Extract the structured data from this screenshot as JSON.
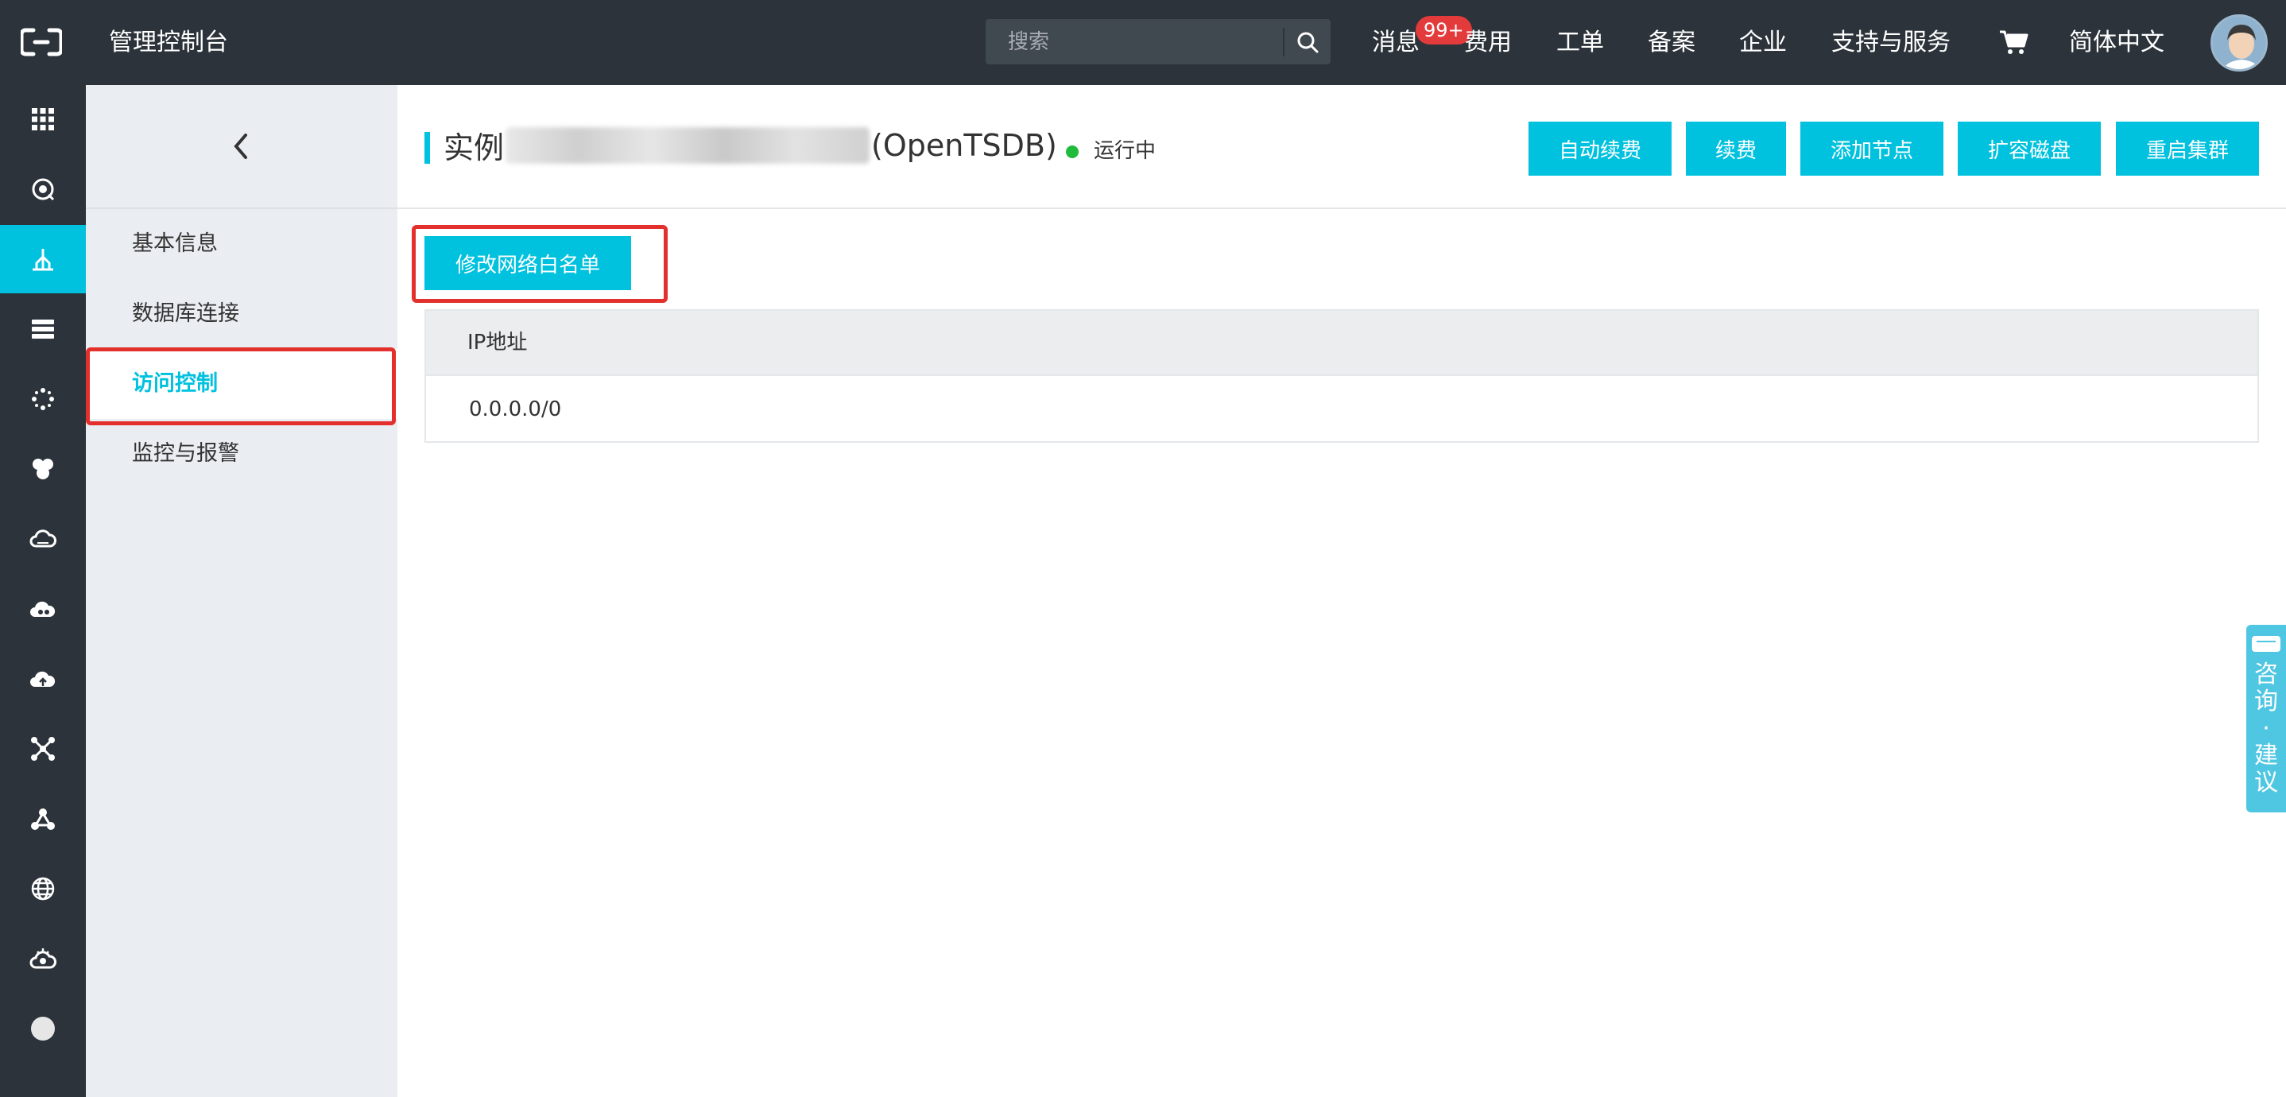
{
  "header": {
    "console_title": "管理控制台",
    "search_placeholder": "搜索",
    "nav": {
      "messages": "消息",
      "messages_badge": "99+",
      "billing": "费用",
      "tickets": "工单",
      "icp": "备案",
      "enterprise": "企业",
      "support": "支持与服务",
      "language": "简体中文"
    }
  },
  "rail": {
    "icons": [
      "grid-icon",
      "search-monitor-icon",
      "tsdb-icon",
      "database-icon",
      "dots-icon",
      "cluster-icon",
      "cloud-icon",
      "cloud-group-icon",
      "cloud-upload-icon",
      "network-icon",
      "share-icon",
      "globe-icon",
      "settings-cloud-icon",
      "circle-icon"
    ],
    "active_index": 2
  },
  "subnav": {
    "items": [
      {
        "label": "基本信息"
      },
      {
        "label": "数据库连接"
      },
      {
        "label": "访问控制"
      },
      {
        "label": "监控与报警"
      }
    ],
    "active_index": 2
  },
  "instance": {
    "title_prefix": "实例",
    "title_suffix": "(OpenTSDB)",
    "status": "运行中",
    "status_color": "#1fbb3a"
  },
  "actions": {
    "auto_renew": "自动续费",
    "renew": "续费",
    "add_node": "添加节点",
    "expand_disk": "扩容磁盘",
    "restart_cluster": "重启集群"
  },
  "access_control": {
    "modify_whitelist": "修改网络白名单",
    "table_header": "IP地址",
    "rows": [
      "0.0.0.0/0"
    ]
  },
  "consult": {
    "label": "咨询·建议"
  },
  "colors": {
    "accent": "#00c1de",
    "topbar": "#2c333a",
    "highlight": "#e3302c",
    "badge": "#e33b3b"
  }
}
